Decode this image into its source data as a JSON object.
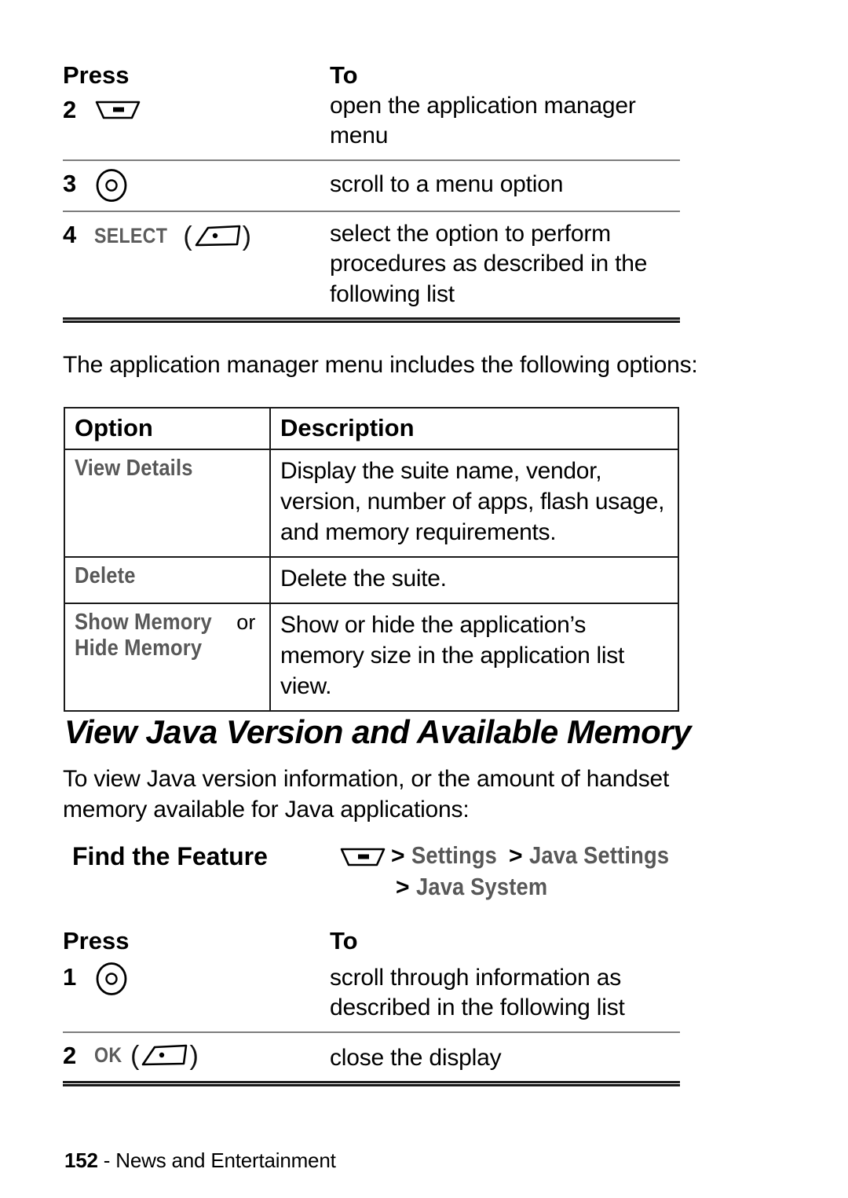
{
  "table_steps_top": {
    "header": {
      "press": "Press",
      "to": "To"
    },
    "rows": [
      {
        "num": "2",
        "key_icon": "menu-key-icon",
        "soft_label": "",
        "to": "open the application manager menu"
      },
      {
        "num": "3",
        "key_icon": "navigation-key-icon",
        "soft_label": "",
        "to": "scroll to a menu option"
      },
      {
        "num": "4",
        "key_icon": "soft-key-icon",
        "soft_label": "SELECT",
        "to": "select the option to perform procedures as described in the following list"
      }
    ]
  },
  "intro_paragraph": "The application manager menu includes the following options:",
  "option_table": {
    "headers": {
      "option": "Option",
      "description": "Description"
    },
    "rows": [
      {
        "option": "View Details",
        "option_suffix": "",
        "option_second": "",
        "description": "Display the suite name, vendor, version, number of apps, flash usage, and memory requirements."
      },
      {
        "option": "Delete",
        "option_suffix": "",
        "option_second": "",
        "description": "Delete the suite."
      },
      {
        "option": "Show Memory",
        "option_suffix": " or",
        "option_second": "Hide Memory",
        "description": "Show or hide the application’s memory size in the application list view."
      }
    ]
  },
  "section_heading": "View Java Version and Available Memory",
  "section_intro": "To view Java version information, or the amount of handset memory available for Java applications:",
  "find_the_feature": {
    "label": "Find the Feature",
    "icon": "menu-key-icon",
    "separator": ">",
    "crumbs": [
      "Settings",
      "Java Settings",
      "Java System"
    ]
  },
  "table_steps_bottom": {
    "header": {
      "press": "Press",
      "to": "To"
    },
    "rows": [
      {
        "num": "1",
        "key_icon": "navigation-key-icon",
        "soft_label": "",
        "to": "scroll through information as described in the following list"
      },
      {
        "num": "2",
        "key_icon": "soft-key-icon",
        "soft_label": "OK",
        "to": "close the display"
      }
    ]
  },
  "footer": {
    "page_number": "152",
    "separator": " - ",
    "chapter": "News and Entertainment"
  },
  "colors": {
    "text": "#000000",
    "soft_key_gray": "#585858",
    "rule_gray": "#7d7d7d",
    "border": "#1a1a1a",
    "background": "#ffffff"
  }
}
